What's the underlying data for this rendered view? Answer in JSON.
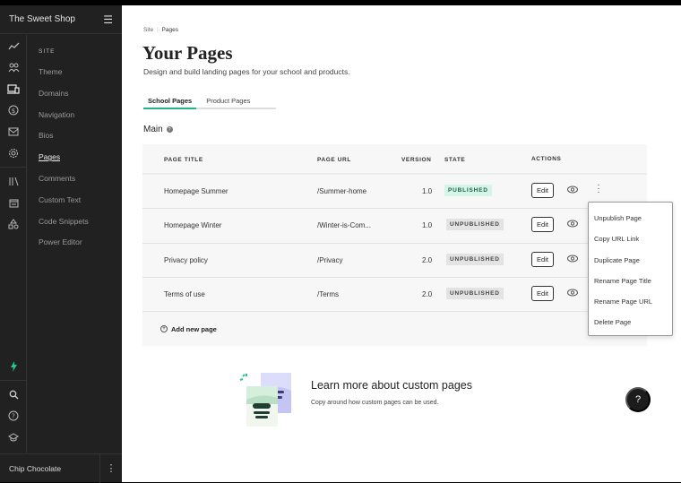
{
  "sidebar": {
    "title": "The Sweet Shop",
    "collapse_icon": "collapse-menu-icon",
    "rail_icons": [
      "analytics-icon",
      "users-icon",
      "devices-icon",
      "dollar-icon",
      "mail-icon",
      "gear-icon",
      "library-icon",
      "calendar-icon",
      "shapes-icon"
    ],
    "rail_bottom_icons": [
      "bolt-icon",
      "search-icon",
      "help-icon",
      "graduation-cap-icon"
    ],
    "section_label": "SITE",
    "items": [
      {
        "label": "Theme"
      },
      {
        "label": "Domains"
      },
      {
        "label": "Navigation"
      },
      {
        "label": "Bios"
      },
      {
        "label": "Pages",
        "active": true
      },
      {
        "label": "Comments"
      },
      {
        "label": "Custom Text"
      },
      {
        "label": "Code Snippets"
      },
      {
        "label": "Power Editor"
      }
    ],
    "user_name": "Chip Chocolate"
  },
  "header": {
    "breadcrumb": [
      "Site",
      "Pages"
    ],
    "title": "Your Pages",
    "subtitle": "Design and build landing pages for your school and products."
  },
  "tabs": [
    {
      "label": "School Pages",
      "active": true
    },
    {
      "label": "Product Pages",
      "active": false
    }
  ],
  "section_title": "Main",
  "table": {
    "columns": [
      "PAGE TITLE",
      "PAGE URL",
      "VERSION",
      "STATE",
      "ACTIONS"
    ],
    "rows": [
      {
        "title": "Homepage Summer",
        "url": "/Summer-home",
        "version": "1.0",
        "state": "PUBLISHED",
        "edit": "Edit"
      },
      {
        "title": "Homepage Winter",
        "url": "/Winter-is-Com...",
        "version": "1.0",
        "state": "UNPUBLISHED",
        "edit": "Edit"
      },
      {
        "title": "Privacy policy",
        "url": "/Privacy",
        "version": "2.0",
        "state": "UNPUBLISHED",
        "edit": "Edit"
      },
      {
        "title": "Terms of use",
        "url": "/Terms",
        "version": "2.0",
        "state": "UNPUBLISHED",
        "edit": "Edit"
      }
    ],
    "add_label": "Add new page"
  },
  "context_menu": [
    "Unpublish Page",
    "Copy URL Link",
    "Duplicate Page",
    "Rename Page Title",
    "Rename Page URL",
    "Delete Page"
  ],
  "promo": {
    "title": "Learn more about custom pages",
    "subtitle": "Copy around how custom pages can be used."
  },
  "help_button": "?",
  "colors": {
    "accent": "#22b38a",
    "published_bg": "#d4f5e8",
    "sidebar_bg": "#212121"
  }
}
